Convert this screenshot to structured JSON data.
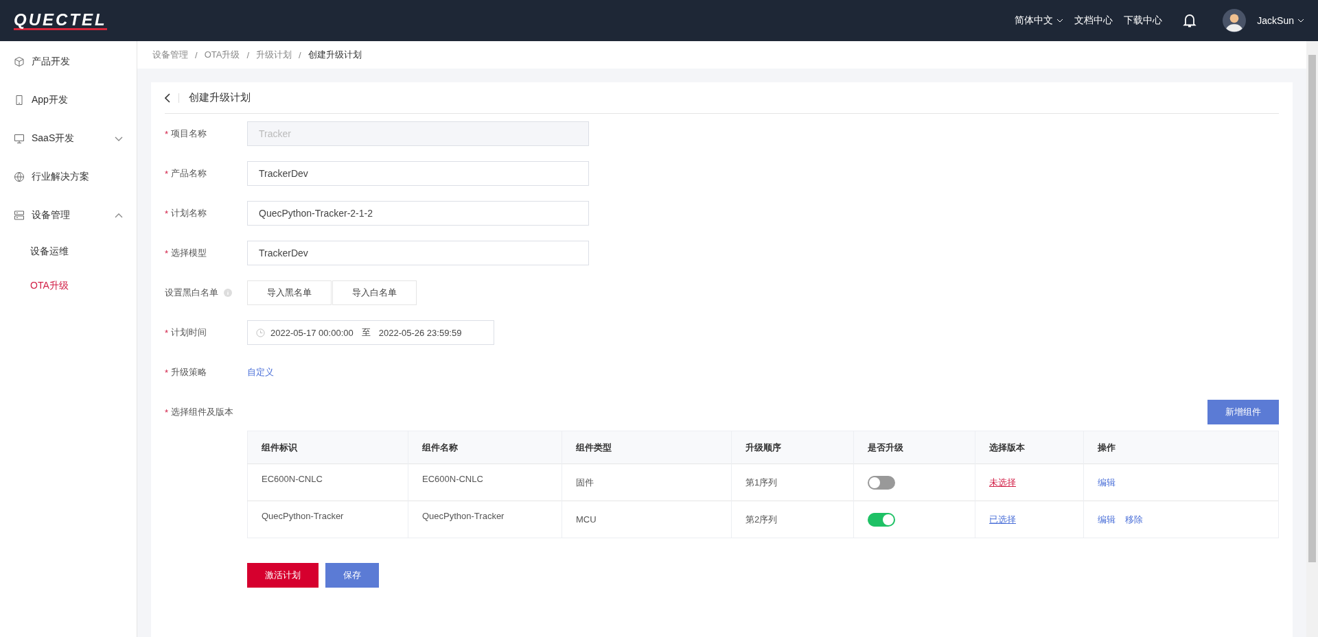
{
  "header": {
    "logo": "QUECTEL",
    "language": "简体中文",
    "links": [
      "文档中心",
      "下载中心"
    ],
    "user": "JackSun"
  },
  "sidebar": {
    "items": [
      {
        "label": "产品开发"
      },
      {
        "label": "App开发"
      },
      {
        "label": "SaaS开发",
        "expanded": false
      },
      {
        "label": "行业解决方案"
      },
      {
        "label": "设备管理",
        "expanded": true,
        "children": [
          {
            "label": "设备运维",
            "selected": false
          },
          {
            "label": "OTA升级",
            "selected": true
          }
        ]
      }
    ]
  },
  "breadcrumb": {
    "separator": "/",
    "items": [
      "设备管理",
      "OTA升级",
      "升级计划",
      "创建升级计划"
    ]
  },
  "page_title": "创建升级计划",
  "form": [
    {
      "kind": "input",
      "mark": "*",
      "label": "项目名称",
      "value": "Tracker",
      "disabled": true
    },
    {
      "kind": "input",
      "mark": "*",
      "label": "产品名称",
      "value": "TrackerDev",
      "disabled": false
    },
    {
      "kind": "input",
      "mark": "*",
      "label": "计划名称",
      "value": "QuecPython-Tracker-2-1-2",
      "disabled": false
    },
    {
      "kind": "input",
      "mark": "*",
      "label": "选择模型",
      "value": "TrackerDev",
      "disabled": false
    },
    {
      "kind": "buttons",
      "label": "设置黑白名单",
      "info": true,
      "buttons": [
        "导入黑名单",
        "导入白名单"
      ]
    },
    {
      "kind": "daterange",
      "mark": "*",
      "label": "计划时间",
      "start": "2022-05-17 00:00:00",
      "separator": "至",
      "end": "2022-05-26 23:59:59"
    },
    {
      "kind": "link",
      "mark": "*",
      "label": "升级策略",
      "value": "自定义"
    }
  ],
  "components": {
    "mark": "*",
    "label": "选择组件及版本",
    "add_button": "新增组件",
    "columns": [
      "组件标识",
      "组件名称",
      "组件类型",
      "升级顺序",
      "是否升级",
      "选择版本",
      "操作"
    ],
    "rows": [
      {
        "id": "EC600N-CNLC",
        "name": "EC600N-CNLC",
        "type": "固件",
        "order": "第1序列",
        "upgrade": false,
        "version": "未选择",
        "version_chosen": false,
        "actions": [
          "编辑"
        ]
      },
      {
        "id": "QuecPython-Tracker",
        "name": "QuecPython-Tracker",
        "type": "MCU",
        "order": "第2序列",
        "upgrade": true,
        "version": "已选择",
        "version_chosen": true,
        "actions": [
          "编辑",
          "移除"
        ]
      }
    ]
  },
  "buttons": [
    {
      "label": "激活计划",
      "kind": "primary"
    },
    {
      "label": "保存",
      "kind": "secondary"
    }
  ]
}
